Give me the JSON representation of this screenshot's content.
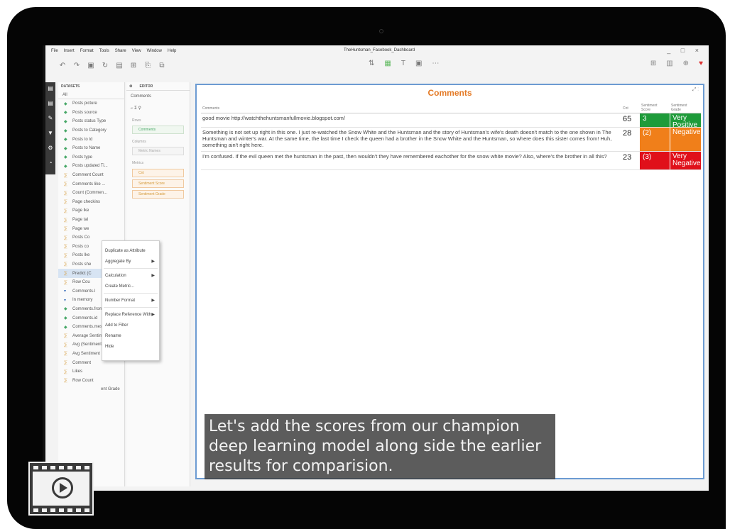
{
  "app": {
    "menu": [
      "File",
      "Insert",
      "Format",
      "Tools",
      "Share",
      "View",
      "Window",
      "Help"
    ],
    "window_title": "TheHuntsman_Facebook_Dashboard",
    "window_controls": "_ □ ×"
  },
  "datasets": {
    "header": "DATASETS",
    "search": "All",
    "items": [
      {
        "label": "Posts picture",
        "kind": "g"
      },
      {
        "label": "Posts source",
        "kind": "g"
      },
      {
        "label": "Posts status Type",
        "kind": "g"
      },
      {
        "label": "Posts to Category",
        "kind": "g"
      },
      {
        "label": "Posts to Id",
        "kind": "g"
      },
      {
        "label": "Posts to Name",
        "kind": "g"
      },
      {
        "label": "Posts type",
        "kind": "g"
      },
      {
        "label": "Posts updated Ti...",
        "kind": "g"
      },
      {
        "label": "Comment Count",
        "kind": "o"
      },
      {
        "label": "Comments like ...",
        "kind": "o"
      },
      {
        "label": "Count (Commen...",
        "kind": "o"
      },
      {
        "label": "Page checkins",
        "kind": "o"
      },
      {
        "label": "Page lke",
        "kind": "o"
      },
      {
        "label": "Page tal",
        "kind": "o"
      },
      {
        "label": "Page we",
        "kind": "o"
      },
      {
        "label": "Posts Co",
        "kind": "o"
      },
      {
        "label": "Posts co",
        "kind": "o"
      },
      {
        "label": "Posts lke",
        "kind": "o"
      },
      {
        "label": "Posts she",
        "kind": "o"
      },
      {
        "label": "Predict (C",
        "kind": "o",
        "selected": true
      },
      {
        "label": "Row Cou",
        "kind": "o"
      },
      {
        "label": "Comments-l",
        "kind": "b"
      },
      {
        "label": "In memory",
        "kind": "b"
      },
      {
        "label": "Comments.from ...",
        "kind": "g"
      },
      {
        "label": "Comments.id",
        "kind": "g"
      },
      {
        "label": "Comments.mess...",
        "kind": "g"
      },
      {
        "label": "Average Sentiment",
        "kind": "o"
      },
      {
        "label": "Avg (Sentiment ...",
        "kind": "o"
      },
      {
        "label": "Avg Sentiment",
        "kind": "o"
      },
      {
        "label": "Comment",
        "kind": "o"
      },
      {
        "label": "Likes",
        "kind": "o"
      },
      {
        "label": "Row Count",
        "kind": "o"
      }
    ]
  },
  "editor": {
    "tab_label": "EDITOR",
    "object_name": "Comments",
    "rows_label": "Rows",
    "rows_pill": "Comments",
    "columns_label": "Columns",
    "columns_pill": "Metric Names",
    "metrics_label": "Metrics",
    "metrics": [
      "Cnt",
      "Sentiment Score",
      "Sentiment Grade"
    ]
  },
  "context_menu": {
    "items": [
      {
        "label": "Duplicate as Attribute",
        "arrow": ""
      },
      {
        "label": "Aggregate By",
        "arrow": "▶"
      },
      {
        "label": "Calculation",
        "arrow": "▶"
      },
      {
        "label": "Create Metric...",
        "arrow": ""
      },
      {
        "label": "Number Format",
        "arrow": "▶"
      },
      {
        "label": "Replace Reference With",
        "arrow": "▶"
      },
      {
        "label": "Add to Filter",
        "arrow": ""
      },
      {
        "label": "Rename",
        "arrow": ""
      },
      {
        "label": "Hide",
        "arrow": ""
      }
    ]
  },
  "main": {
    "title": "Comments",
    "columns": {
      "comment": "Comments",
      "count": "Cnt",
      "score": "Sentiment Score",
      "grade": "Sentiment Grade"
    },
    "rows": [
      {
        "comment": "good movie http://watchthehuntsmanfullmovie.blogspot.com/",
        "count": "65",
        "score": "3",
        "grade": "Very Positive",
        "color": "#1e9b3a"
      },
      {
        "comment": "Something is not set up right in this one. I just re-watched the Snow White and the Huntsman and the story of Huntsman's wife's death doesn't match to the one shown in The Huntsman and winter's war. At the same time, the last time I check the queen had a brother in the Snow White and the Huntsman, so where does this sister comes from! Huh, something ain't right here.",
        "count": "28",
        "score": "(2)",
        "grade": "Negative",
        "color": "#f07f1a"
      },
      {
        "comment": "I'm confused. If the evil queen met the huntsman in the past, then wouldn't they have remembered eachother for the snow white movie? Also, where's the brother in all this?",
        "count": "23",
        "score": "(3)",
        "grade": "Very Negative",
        "color": "#e0101a"
      }
    ]
  },
  "caption": "Let's add the scores from our champion deep learning model along side the earlier results for comparision.",
  "last_item_partial": "ent Grade"
}
